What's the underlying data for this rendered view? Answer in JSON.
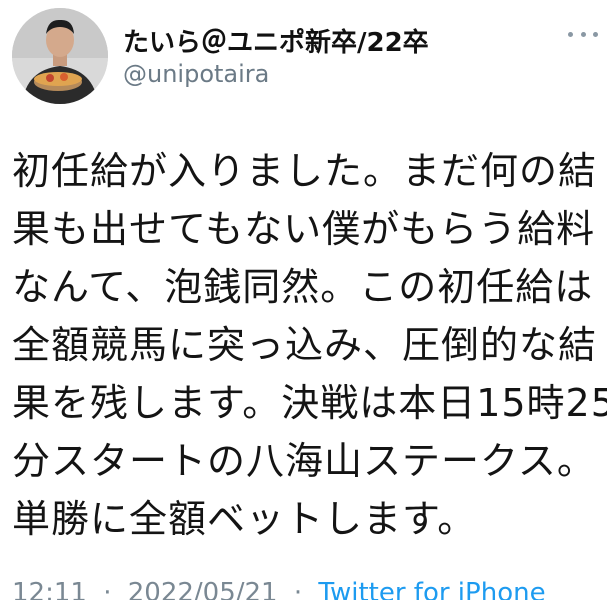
{
  "user": {
    "display_name": "たいら＠ユニポ新卒/22卒",
    "handle": "@unipotaira",
    "avatar_icon": "user-photo-icon",
    "more_icon": "more-options-icon"
  },
  "tweet": {
    "lines": [
      "初任給が入りました。まだ何の結",
      "果も出せてもない僕がもらう給料",
      "なんて、泡銭同然。この初任給は",
      "全額競馬に突っ込み、圧倒的な結",
      "果を残します。決戦は本日15時25",
      "分スタートの八海山ステークス。",
      "単勝に全額ベットします。"
    ]
  },
  "meta": {
    "time": "12:11",
    "date": "2022/05/21",
    "separator": "·",
    "client": "Twitter for iPhone"
  },
  "colors": {
    "text": "#141414",
    "handle": "#6b7a86",
    "link": "#1d9bf0"
  }
}
